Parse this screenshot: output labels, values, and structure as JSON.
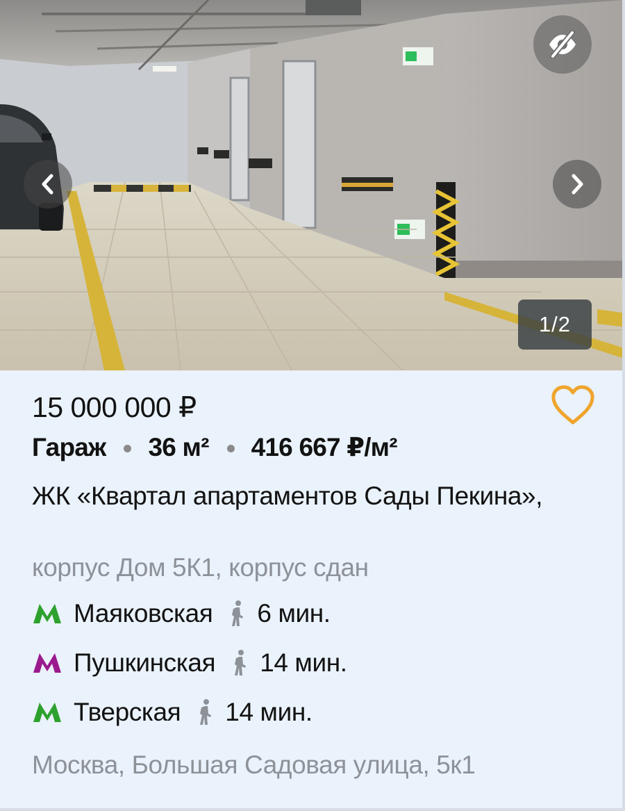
{
  "listing": {
    "gallery": {
      "counter": "1/2",
      "hide_icon": "eye-crossed-icon",
      "prev_icon": "chevron-left-icon",
      "next_icon": "chevron-right-icon"
    },
    "price": "15 000 000 ₽",
    "favorite_icon": "heart-outline-icon",
    "params": {
      "type": "Гараж",
      "area": "36 м²",
      "price_per_m2": "416 667 ₽/м²"
    },
    "complex": "ЖК «Квартал апартаментов Сады Пекина»,",
    "building": "корпус Дом 5К1, корпус сдан",
    "metro": [
      {
        "station": "Маяковская",
        "time": "6 мин.",
        "color": "#2da12d",
        "walk_icon": "pedestrian-icon"
      },
      {
        "station": "Пушкинская",
        "time": "14 мин.",
        "color": "#9b1a8e",
        "walk_icon": "pedestrian-icon"
      },
      {
        "station": "Тверская",
        "time": "14 мин.",
        "color": "#2da12d",
        "walk_icon": "pedestrian-icon"
      }
    ],
    "address": "Москва, Большая Садовая улица, 5к1"
  },
  "colors": {
    "card_background": "#eaf2fb",
    "favorite_accent": "#f0a42c",
    "secondary_text": "#8d9298"
  }
}
